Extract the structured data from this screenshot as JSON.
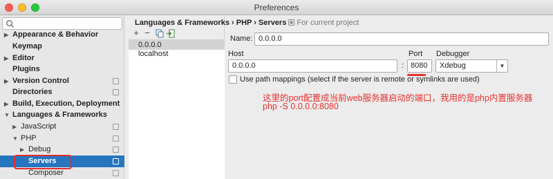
{
  "window": {
    "title": "Preferences"
  },
  "search": {
    "placeholder": ""
  },
  "sidebar": {
    "items": [
      {
        "label": "Appearance & Behavior"
      },
      {
        "label": "Keymap"
      },
      {
        "label": "Editor"
      },
      {
        "label": "Plugins"
      },
      {
        "label": "Version Control"
      },
      {
        "label": "Directories"
      },
      {
        "label": "Build, Execution, Deployment"
      },
      {
        "label": "Languages & Frameworks"
      },
      {
        "label": "JavaScript"
      },
      {
        "label": "PHP"
      },
      {
        "label": "Debug"
      },
      {
        "label": "Servers"
      },
      {
        "label": "Composer"
      }
    ]
  },
  "breadcrumb": {
    "part1": "Languages & Frameworks",
    "sep1": "›",
    "part2": "PHP",
    "sep2": "›",
    "part3": "Servers",
    "scope": "For current project"
  },
  "toolbar": {
    "add": "+",
    "remove": "−"
  },
  "servers": [
    {
      "name": "0.0.0.0"
    },
    {
      "name": "localhost"
    }
  ],
  "form": {
    "name_label": "Name:",
    "name_value": "0.0.0.0",
    "host_label": "Host",
    "host_value": "0.0.0.0",
    "colon": ":",
    "port_label": "Port",
    "port_value": "8080",
    "debugger_label": "Debugger",
    "debugger_value": "Xdebug",
    "path_mappings_label": "Use path mappings (select if the server is remote or symlinks are used)"
  },
  "annotation": {
    "line1": "这里的port配置成当前web服务器启动的端口，我用的是php内置服务器",
    "line2": "php -S 0.0.0.0:8080",
    "color": "#e8312f"
  },
  "colors": {
    "selection": "#2675bf",
    "highlight": "#e32d2d"
  }
}
